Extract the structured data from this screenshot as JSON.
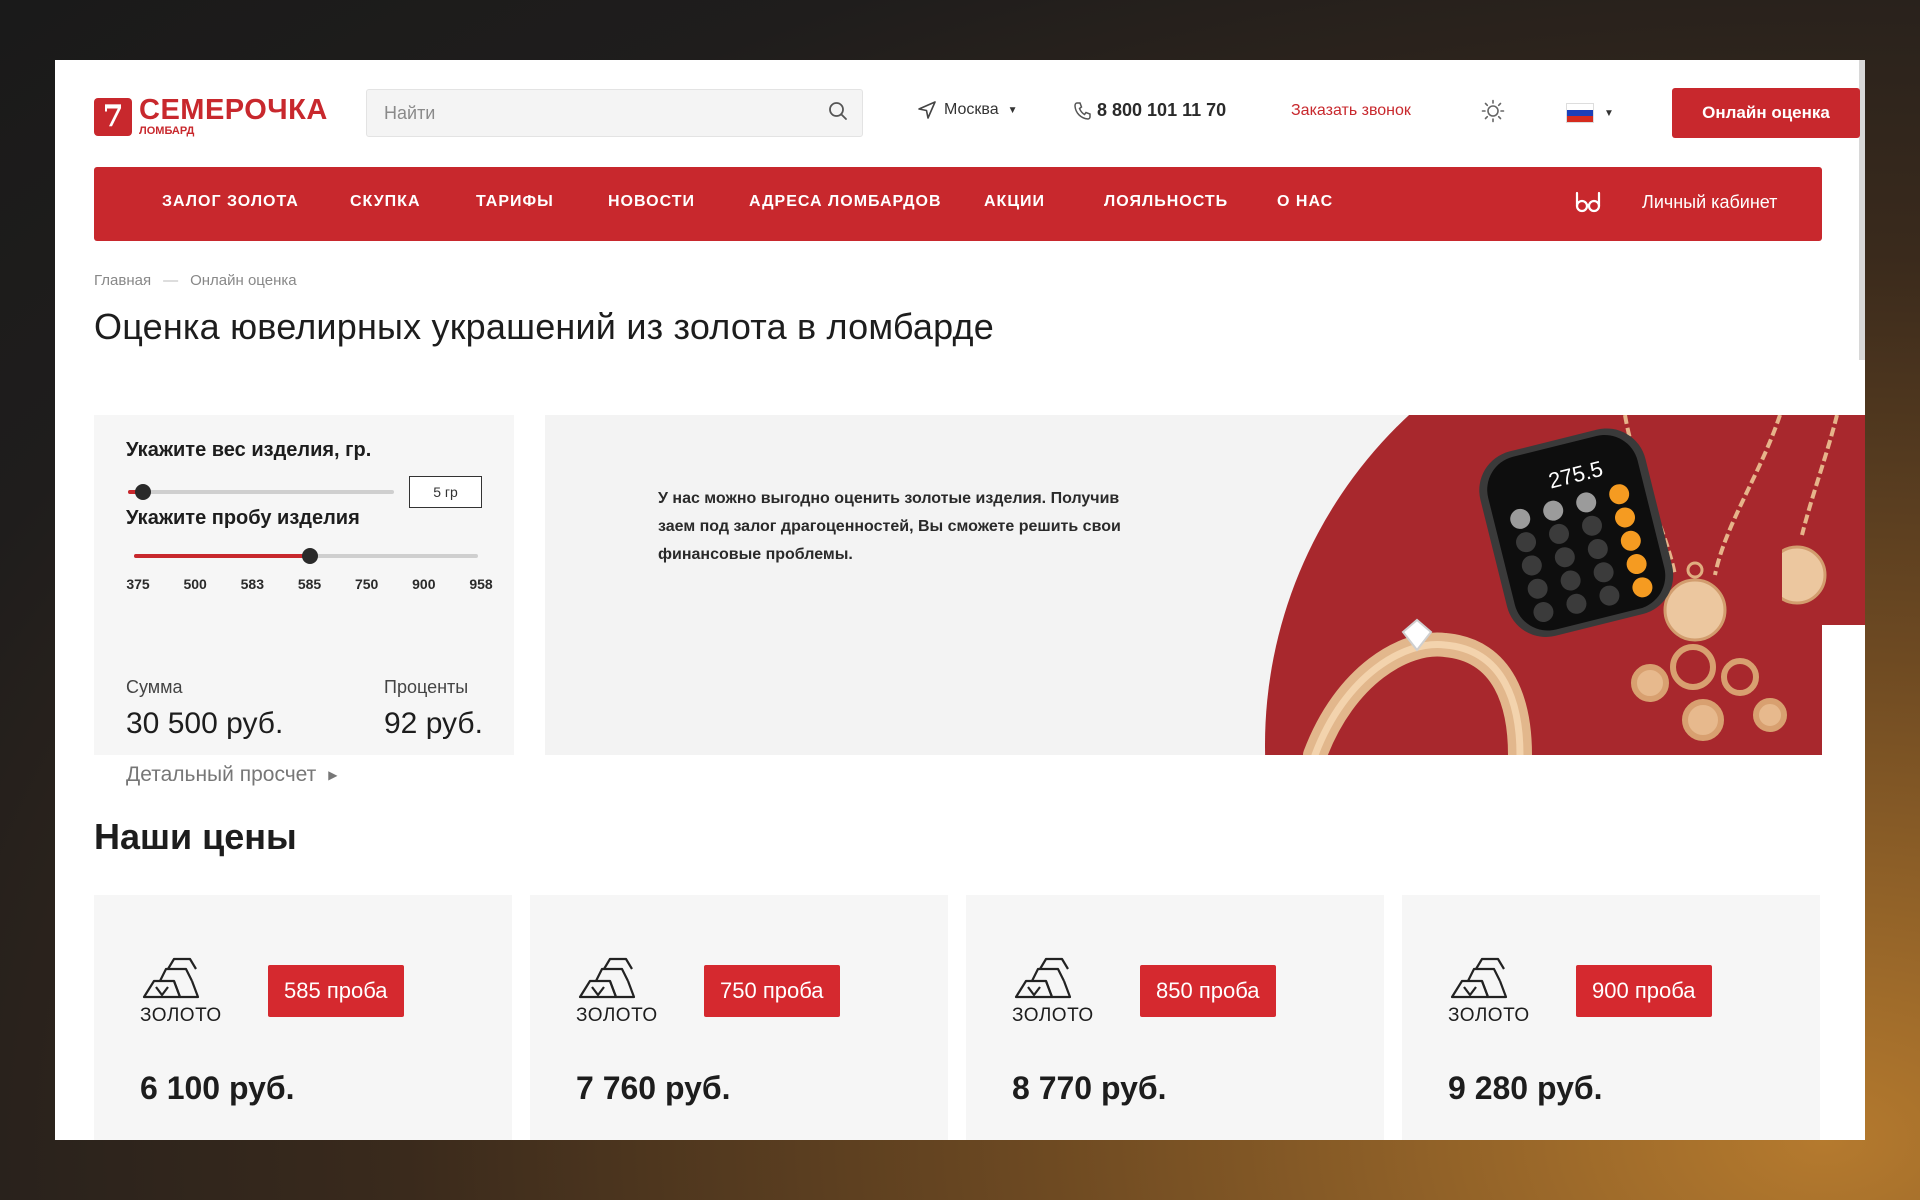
{
  "brand": {
    "name": "СЕМЕРОЧКА",
    "sub": "ЛОМБАРД",
    "mark": "7"
  },
  "search": {
    "placeholder": "Найти"
  },
  "header": {
    "city": "Москва",
    "phone": "8 800 101 11 70",
    "callback": "Заказать звонок",
    "cta": "Онлайн оценка"
  },
  "nav": {
    "items": [
      "ЗАЛОГ ЗОЛОТА",
      "СКУПКА",
      "ТАРИФЫ",
      "НОВОСТИ",
      "АДРЕСА ЛОМБАРДОВ",
      "АКЦИИ",
      "ЛОЯЛЬНОСТЬ",
      "О НАС"
    ],
    "cabinet": "Личный кабинет"
  },
  "breadcrumb": {
    "home": "Главная",
    "sep": "—",
    "current": "Онлайн оценка"
  },
  "page_title": "Оценка ювелирных украшений из золота в ломбарде",
  "calculator": {
    "weight_label": "Укажите вес изделия, гр.",
    "weight_value": "5 гр",
    "weight_level": 0.04,
    "purity_label": "Укажите пробу изделия",
    "purity_ticks": [
      "375",
      "500",
      "583",
      "585",
      "750",
      "900",
      "958"
    ],
    "purity_selected": "585",
    "sum_label": "Сумма",
    "sum_value": "30 500 руб.",
    "interest_label": "Проценты",
    "interest_value": "92 руб.",
    "detail_link": "Детальный просчет"
  },
  "banner": {
    "text": "У нас можно выгодно оценить золотые изделия. Получив заем под залог драгоценностей, Вы сможете решить свои финансовые проблемы.",
    "calculator_display": "275.5"
  },
  "prices": {
    "title": "Наши цены",
    "cards": [
      {
        "label": "ЗОЛОТО",
        "badge": "585 проба",
        "price": "6 100 руб."
      },
      {
        "label": "ЗОЛОТО",
        "badge": "750 проба",
        "price": "7 760 руб."
      },
      {
        "label": "ЗОЛОТО",
        "badge": "850 проба",
        "price": "8 770 руб."
      },
      {
        "label": "ЗОЛОТО",
        "badge": "900 проба",
        "price": "9 280 руб."
      }
    ]
  },
  "colors": {
    "accent": "#c8282d",
    "banner_red": "#a8282d",
    "panel": "#f6f6f6"
  },
  "icons": [
    "search-icon",
    "location-arrow-icon",
    "phone-icon",
    "sun-icon",
    "russia-flag-icon",
    "glasses-icon",
    "gold-bars-icon",
    "chevron-right-icon",
    "chevron-down-icon"
  ]
}
